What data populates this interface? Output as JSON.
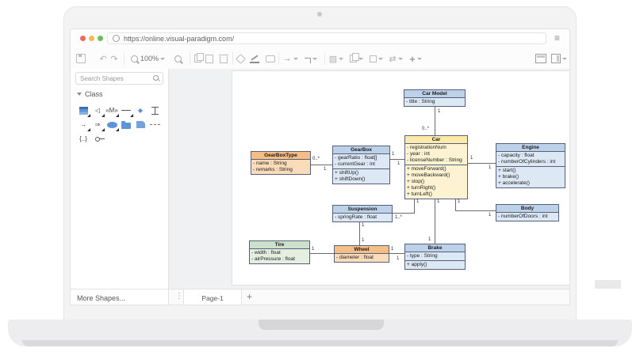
{
  "browser": {
    "url": "https://online.visual-paradigm.com/",
    "traffic_lights": {
      "close": "#ee6a5f",
      "minimize": "#f5bd4f",
      "maximize": "#61c454"
    }
  },
  "toolbar": {
    "zoom_level": "100%",
    "icons": [
      "save-icon",
      "undo-icon",
      "redo-icon",
      "zoom-out-icon",
      "zoom-level-dropdown",
      "zoom-in-icon",
      "copy-icon",
      "paste-icon",
      "delete-icon",
      "fill-color-icon",
      "line-color-icon",
      "shape-icon",
      "arrow-style-icon",
      "connector-style-icon",
      "shadow-icon",
      "layers-icon",
      "bring-forward-icon",
      "swap-icon",
      "insert-icon",
      "format-panel-icon",
      "outline-panel-icon"
    ]
  },
  "sidebar": {
    "search_placeholder": "Search Shapes",
    "section_class": "Class",
    "more_shapes": "More Shapes...",
    "palette_icons": [
      "class-shape-icon",
      "generalization-arrow-icon",
      "stereotype-icon",
      "association-line-icon",
      "diamond-shape-icon",
      "terminator-shape-icon",
      "dependency-arrow-icon",
      "labeled-arrow-icon",
      "ellipse-shape-icon",
      "package-shape-icon",
      "note-shape-icon",
      "dashed-line-icon",
      "braces-icon",
      "pin-connector-icon"
    ]
  },
  "statusbar": {
    "page_tab": "Page-1",
    "add_page": "+"
  },
  "diagram": {
    "classes": [
      {
        "name": "Car Model",
        "attributes": [
          "- title : String"
        ],
        "operations": []
      },
      {
        "name": "Car",
        "attributes": [
          "- registrationNum",
          "- year : int",
          "- licenseNumber : String"
        ],
        "operations": [
          "+ moveForward()",
          "+ moveBackward()",
          "+ stop()",
          "+ turnRight()",
          "+ turnLeft()"
        ]
      },
      {
        "name": "Engine",
        "attributes": [
          "- capacity : float",
          "- numberOfCylinders : int"
        ],
        "operations": [
          "+ start()",
          "+ brake()",
          "+ accelerate()"
        ]
      },
      {
        "name": "GearBoxType",
        "attributes": [
          "- name : String",
          "- remarks : String"
        ],
        "operations": []
      },
      {
        "name": "GearBox",
        "attributes": [
          "- gearRatio : float[]",
          "- currentGear : int"
        ],
        "operations": [
          "+ shiftUp()",
          "+ shiftDown()"
        ]
      },
      {
        "name": "Suspension",
        "attributes": [
          "- springRate : float"
        ],
        "operations": []
      },
      {
        "name": "Body",
        "attributes": [
          "- numberOfDoors : int"
        ],
        "operations": []
      },
      {
        "name": "Tire",
        "attributes": [
          "- width : float",
          "- airPressure : float"
        ],
        "operations": []
      },
      {
        "name": "Wheel",
        "attributes": [
          "- diameter : float"
        ],
        "operations": []
      },
      {
        "name": "Brake",
        "attributes": [
          "- type : String"
        ],
        "operations": [
          "+ apply()"
        ]
      }
    ],
    "multiplicities": [
      "1",
      "0..*",
      "0..*",
      "1",
      "1",
      "1",
      "1",
      "1",
      "1",
      "1..*",
      "1",
      "1",
      "1",
      "1",
      "1",
      "1",
      "1",
      "1",
      "1"
    ],
    "colors": {
      "blue_header": "#bdd2e9",
      "yellow_header": "#ffe9a8",
      "orange_header": "#f6bd85",
      "green_header": "#cde0c9"
    }
  }
}
